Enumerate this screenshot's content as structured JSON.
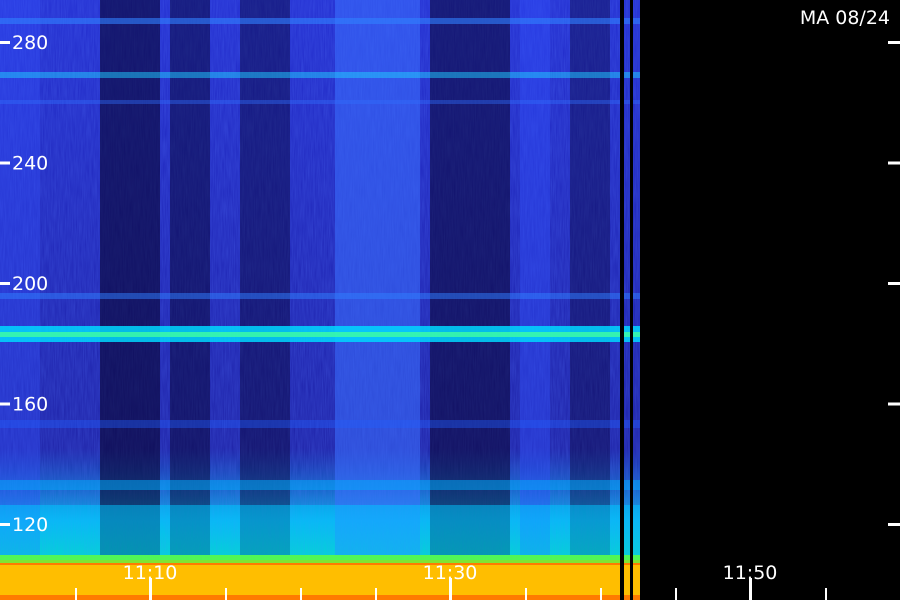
{
  "station_label": "MA 08/24",
  "y_axis": {
    "ticks": [
      {
        "value": 280,
        "label": "280"
      },
      {
        "value": 240,
        "label": "240"
      },
      {
        "value": 200,
        "label": "200"
      },
      {
        "value": 160,
        "label": "160"
      },
      {
        "value": 120,
        "label": "120"
      }
    ]
  },
  "x_axis": {
    "ticks": [
      {
        "label": "11:10"
      },
      {
        "label": "11:30"
      },
      {
        "label": "11:50"
      }
    ]
  },
  "colors": {
    "background": "#000000",
    "low": "#1a0a6e",
    "mid": "#1e3cff",
    "high": "#00e0ff",
    "band": "#ffd000",
    "label": "#ffffff"
  }
}
